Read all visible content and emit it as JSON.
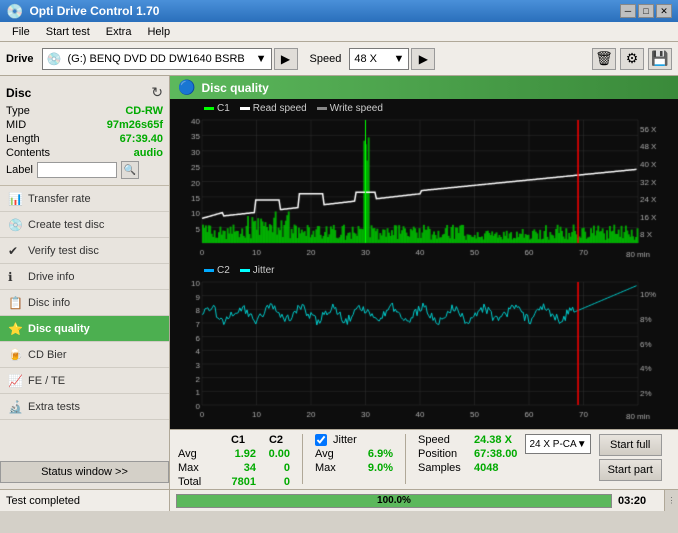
{
  "titlebar": {
    "title": "Opti Drive Control 1.70",
    "icon": "🔵"
  },
  "menu": {
    "items": [
      "File",
      "Start test",
      "Extra",
      "Help"
    ]
  },
  "toolbar": {
    "drive_label": "Drive",
    "drive_value": "(G:)  BENQ DVD DD DW1640 BSRB",
    "speed_label": "Speed",
    "speed_value": "48 X"
  },
  "disc": {
    "title": "Disc",
    "type_label": "Type",
    "type_value": "CD-RW",
    "mid_label": "MID",
    "mid_value": "97m26s65f",
    "length_label": "Length",
    "length_value": "67:39.40",
    "contents_label": "Contents",
    "contents_value": "audio",
    "label_label": "Label",
    "label_value": ""
  },
  "sidebar_items": [
    {
      "id": "transfer-rate",
      "label": "Transfer rate",
      "icon": "📊"
    },
    {
      "id": "create-test-disc",
      "label": "Create test disc",
      "icon": "💿"
    },
    {
      "id": "verify-test-disc",
      "label": "Verify test disc",
      "icon": "✔"
    },
    {
      "id": "drive-info",
      "label": "Drive info",
      "icon": "ℹ"
    },
    {
      "id": "disc-info",
      "label": "Disc info",
      "icon": "📋"
    },
    {
      "id": "disc-quality",
      "label": "Disc quality",
      "icon": "⭐",
      "active": true
    },
    {
      "id": "cd-bier",
      "label": "CD Bier",
      "icon": "🍺"
    },
    {
      "id": "fe-te",
      "label": "FE / TE",
      "icon": "📈"
    },
    {
      "id": "extra-tests",
      "label": "Extra tests",
      "icon": "🔬"
    }
  ],
  "disc_quality": {
    "title": "Disc quality",
    "legend": {
      "c1": "C1",
      "read_speed": "Read speed",
      "write_speed": "Write speed",
      "c2": "C2",
      "jitter": "Jitter"
    }
  },
  "stats": {
    "columns": {
      "c1": "C1",
      "c2": "C2"
    },
    "rows": {
      "avg_label": "Avg",
      "avg_c1": "1.92",
      "avg_c2": "0.00",
      "max_label": "Max",
      "max_c1": "34",
      "max_c2": "0",
      "total_label": "Total",
      "total_c1": "7801",
      "total_c2": "0"
    },
    "jitter": {
      "checked": true,
      "label": "Jitter",
      "avg_val": "6.9%",
      "max_val": "9.0%"
    },
    "speed": {
      "label": "Speed",
      "value": "24.38 X",
      "position_label": "Position",
      "position_value": "67:38.00",
      "samples_label": "Samples",
      "samples_value": "4048"
    },
    "cav_label": "24 X P-CA",
    "buttons": {
      "start_full": "Start full",
      "start_part": "Start part"
    }
  },
  "statusbar": {
    "status_window": "Status window >>",
    "completed_text": "Test completed",
    "progress_percent": "100.0%",
    "time": "03:20"
  },
  "chart1": {
    "y_max": 40,
    "y_labels": [
      0,
      5,
      10,
      15,
      20,
      25,
      30,
      35,
      40
    ],
    "y_right_labels": [
      "8 X",
      "16 X",
      "24 X",
      "32 X",
      "40 X",
      "48 X",
      "56 X"
    ],
    "x_labels": [
      0,
      10,
      20,
      30,
      40,
      50,
      60,
      70,
      80
    ],
    "x_suffix": "min"
  },
  "chart2": {
    "y_max": 10,
    "y_labels": [
      1,
      2,
      3,
      4,
      5,
      6,
      7,
      8,
      9,
      10
    ],
    "y_right_labels": [
      "2%",
      "4%",
      "6%",
      "8%",
      "10%"
    ],
    "x_labels": [
      0,
      10,
      20,
      30,
      40,
      50,
      60,
      70,
      80
    ],
    "x_suffix": "min"
  }
}
